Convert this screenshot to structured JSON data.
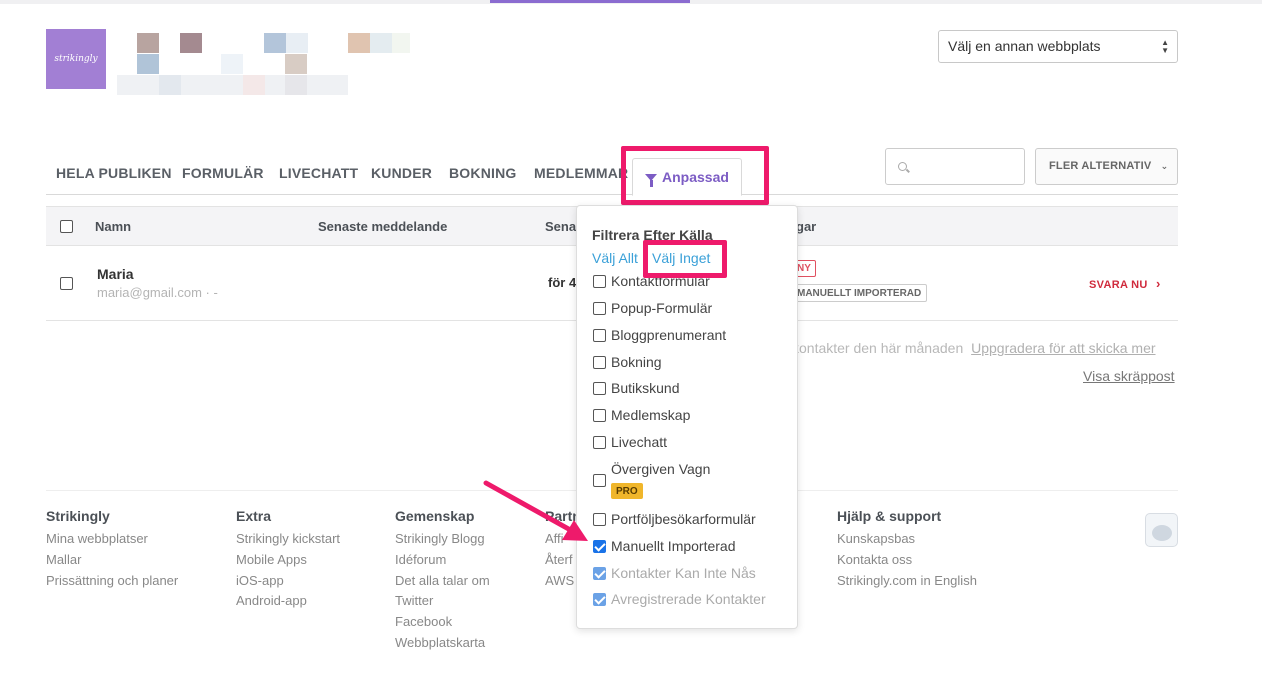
{
  "header": {
    "logo_text": "strikingly",
    "site_select": "Välj en annan webbplats"
  },
  "tabs": {
    "items": [
      "HELA PUBLIKEN",
      "FORMULÄR",
      "LIVECHATT",
      "KUNDER",
      "BOKNING",
      "MEDLEMMAR"
    ],
    "active": "Anpassad",
    "search_placeholder": "",
    "more_label": "FLER ALTERNATIV"
  },
  "table": {
    "columns": [
      "Namn",
      "Senaste meddelande",
      "Sena",
      "gar"
    ],
    "rows": [
      {
        "name": "Maria",
        "email": "maria@gmail.com · -",
        "sent": "för 4",
        "badge_new": "NY",
        "badge_imported": "MANUELLT IMPORTERAD",
        "reply": "SVARA NU"
      }
    ]
  },
  "limit_note": {
    "text": "kontakter den här månaden",
    "upgrade_link": "Uppgradera för att skicka mer"
  },
  "spam_link": "Visa skräppost",
  "filter_dropdown": {
    "title": "Filtrera Efter Källa",
    "select_all": "Välj Allt",
    "select_none": "Välj Inget",
    "options": [
      {
        "label": "Kontaktformulär",
        "checked": false,
        "disabled": false
      },
      {
        "label": "Popup-Formulär",
        "checked": false,
        "disabled": false
      },
      {
        "label": "Bloggprenumerant",
        "checked": false,
        "disabled": false
      },
      {
        "label": "Bokning",
        "checked": false,
        "disabled": false
      },
      {
        "label": "Butikskund",
        "checked": false,
        "disabled": false
      },
      {
        "label": "Medlemskap",
        "checked": false,
        "disabled": false
      },
      {
        "label": "Livechatt",
        "checked": false,
        "disabled": false
      },
      {
        "label": "Övergiven Vagn",
        "checked": false,
        "disabled": false,
        "badge": "PRO"
      },
      {
        "label": "Portföljbesökarformulär",
        "checked": false,
        "disabled": false
      },
      {
        "label": "Manuellt Importerad",
        "checked": true,
        "disabled": false
      },
      {
        "label": "Kontakter Kan Inte Nås",
        "checked": true,
        "disabled": true
      },
      {
        "label": "Avregistrerade Kontakter",
        "checked": true,
        "disabled": true
      }
    ]
  },
  "footer": {
    "columns": [
      {
        "title": "Strikingly",
        "links": [
          "Mina webbplatser",
          "Mallar",
          "Prissättning och planer"
        ]
      },
      {
        "title": "Extra",
        "links": [
          "Strikingly kickstart",
          "Mobile Apps",
          "iOS-app",
          "Android-app"
        ]
      },
      {
        "title": "Gemenskap",
        "links": [
          "Strikingly Blogg",
          "Idéforum",
          "Det alla talar om",
          "Twitter",
          "Facebook",
          "Webbplatskarta"
        ]
      },
      {
        "title": "Partn",
        "links": [
          "Affi",
          "Återf",
          "AWS S"
        ]
      },
      {
        "title": "Hjälp & support",
        "links": [
          "Kunskapsbas",
          "Kontakta oss",
          "Strikingly.com in English"
        ]
      }
    ]
  },
  "colors": {
    "accent_purple": "#7c5cc4",
    "highlight_pink": "#ee1a6b",
    "link_blue": "#3aa0d8",
    "reply_red": "#d02b3d",
    "pro_yellow": "#f0b62b"
  }
}
